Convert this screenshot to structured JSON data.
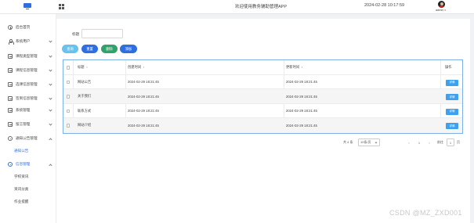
{
  "header": {
    "app_title": "欢迎使用教务辅助管理APP",
    "datetime": "2024-02-28 10:17:59",
    "username": "admin"
  },
  "sidebar": {
    "items": [
      {
        "label": "后台首页",
        "icon": "clock-icon"
      },
      {
        "label": "系统用户",
        "icon": "user-icon"
      },
      {
        "label": "课程类型管理",
        "icon": "box-icon"
      },
      {
        "label": "课程信息管理",
        "icon": "box-icon"
      },
      {
        "label": "选课信息管理",
        "icon": "box-icon"
      },
      {
        "label": "签到信息管理",
        "icon": "box-icon"
      },
      {
        "label": "系统管理",
        "icon": "box-icon"
      },
      {
        "label": "留言管理",
        "icon": "box-icon"
      },
      {
        "label": "通知公告管理",
        "icon": "circle-icon"
      }
    ],
    "sub_open": "通知公告",
    "current_group": "信息管理",
    "sub_items": [
      "学校资讯",
      "资讯分类",
      "作业提醒"
    ]
  },
  "search": {
    "label": "标题",
    "value": ""
  },
  "buttons": {
    "search": "查询",
    "reset": "重置",
    "delete": "删除",
    "add": "添加"
  },
  "table": {
    "headers": [
      "标题",
      "创建时间",
      "更新时间",
      "操作"
    ],
    "detail_label": "详情",
    "rows": [
      {
        "title": "网站公告",
        "created": "2024-02-29 18:21:45",
        "updated": "2024-02-29 18:21:45"
      },
      {
        "title": "关于我们",
        "created": "2024-02-29 18:21:45",
        "updated": "2024-02-29 18:21:45"
      },
      {
        "title": "联系方式",
        "created": "2024-02-29 18:21:45",
        "updated": "2024-02-29 18:21:45"
      },
      {
        "title": "网站介绍",
        "created": "2024-02-29 18:21:45",
        "updated": "2024-02-29 18:21:45"
      }
    ]
  },
  "pagination": {
    "total": "共 4 条",
    "page_size": "10条/页",
    "prev": "<",
    "current": "1",
    "next": ">",
    "goto": "前往",
    "goto_value": "1",
    "unit": "页"
  },
  "watermark": "CSDN @MZ_ZXD001"
}
